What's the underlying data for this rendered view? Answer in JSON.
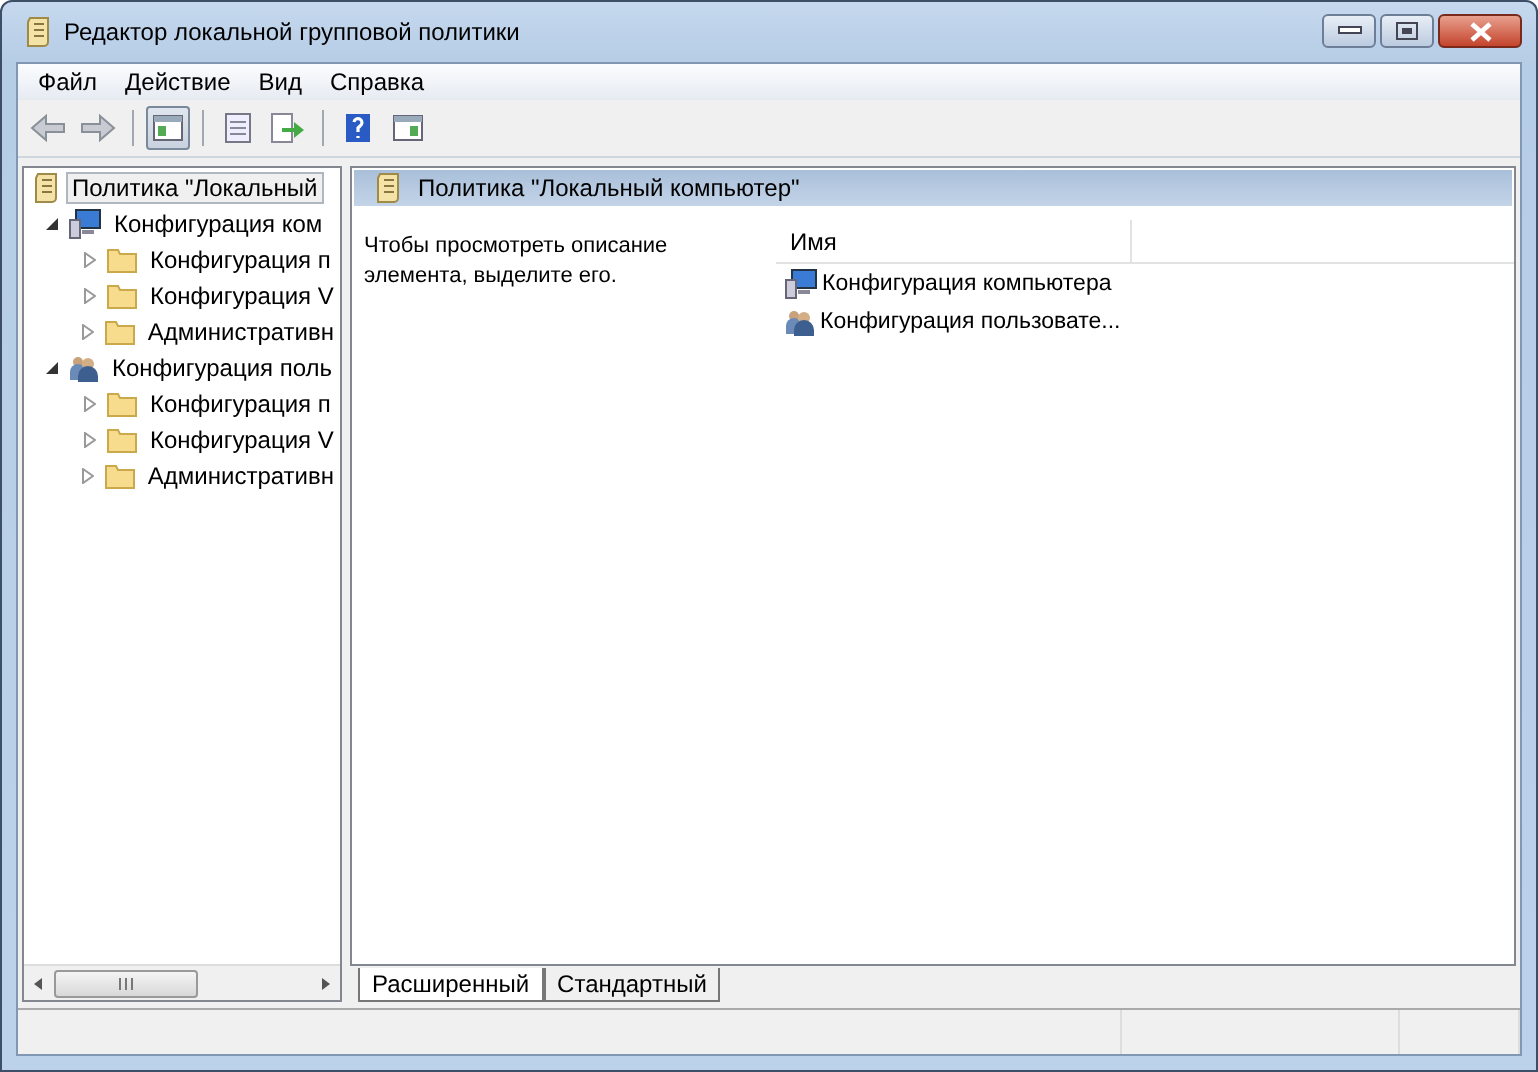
{
  "window": {
    "title": "Редактор локальной групповой политики"
  },
  "menu": [
    "Файл",
    "Действие",
    "Вид",
    "Справка"
  ],
  "toolbar": [
    {
      "kind": "back",
      "pressed": false
    },
    {
      "kind": "forward",
      "pressed": false
    },
    {
      "kind": "separator"
    },
    {
      "kind": "tree",
      "pressed": true
    },
    {
      "kind": "separator"
    },
    {
      "kind": "properties",
      "pressed": false
    },
    {
      "kind": "export",
      "pressed": false
    },
    {
      "kind": "separator"
    },
    {
      "kind": "help",
      "pressed": false
    },
    {
      "kind": "pane",
      "pressed": false
    }
  ],
  "tree": {
    "label": "Политика \"Локальный",
    "kind": "policy",
    "selected": true,
    "children": [
      {
        "label": "Конфигурация ком",
        "kind": "computer",
        "expanded": true,
        "selected": false,
        "children": [
          {
            "label": "Конфигурация п",
            "kind": "folder",
            "expanded": false,
            "selected": false
          },
          {
            "label": "Конфигурация V",
            "kind": "folder",
            "expanded": false,
            "selected": false
          },
          {
            "label": "Административн",
            "kind": "folder",
            "expanded": false,
            "selected": false
          }
        ]
      },
      {
        "label": "Конфигурация поль",
        "kind": "user",
        "expanded": true,
        "selected": false,
        "children": [
          {
            "label": "Конфигурация п",
            "kind": "folder",
            "expanded": false,
            "selected": false
          },
          {
            "label": "Конфигурация V",
            "kind": "folder",
            "expanded": false,
            "selected": false
          },
          {
            "label": "Административн",
            "kind": "folder",
            "expanded": false,
            "selected": false
          }
        ]
      }
    ]
  },
  "details": {
    "title": "Политика \"Локальный компьютер\"",
    "description": "Чтобы просмотреть описание элемента, выделите его.",
    "columns": [
      "Имя"
    ],
    "rows": [
      {
        "name": "Конфигурация компьютера",
        "kind": "computer"
      },
      {
        "name": "Конфигурация пользовате...",
        "kind": "user"
      }
    ]
  },
  "tabs": [
    {
      "label": "Расширенный",
      "selected": true
    },
    {
      "label": "Стандартный",
      "selected": false
    }
  ]
}
